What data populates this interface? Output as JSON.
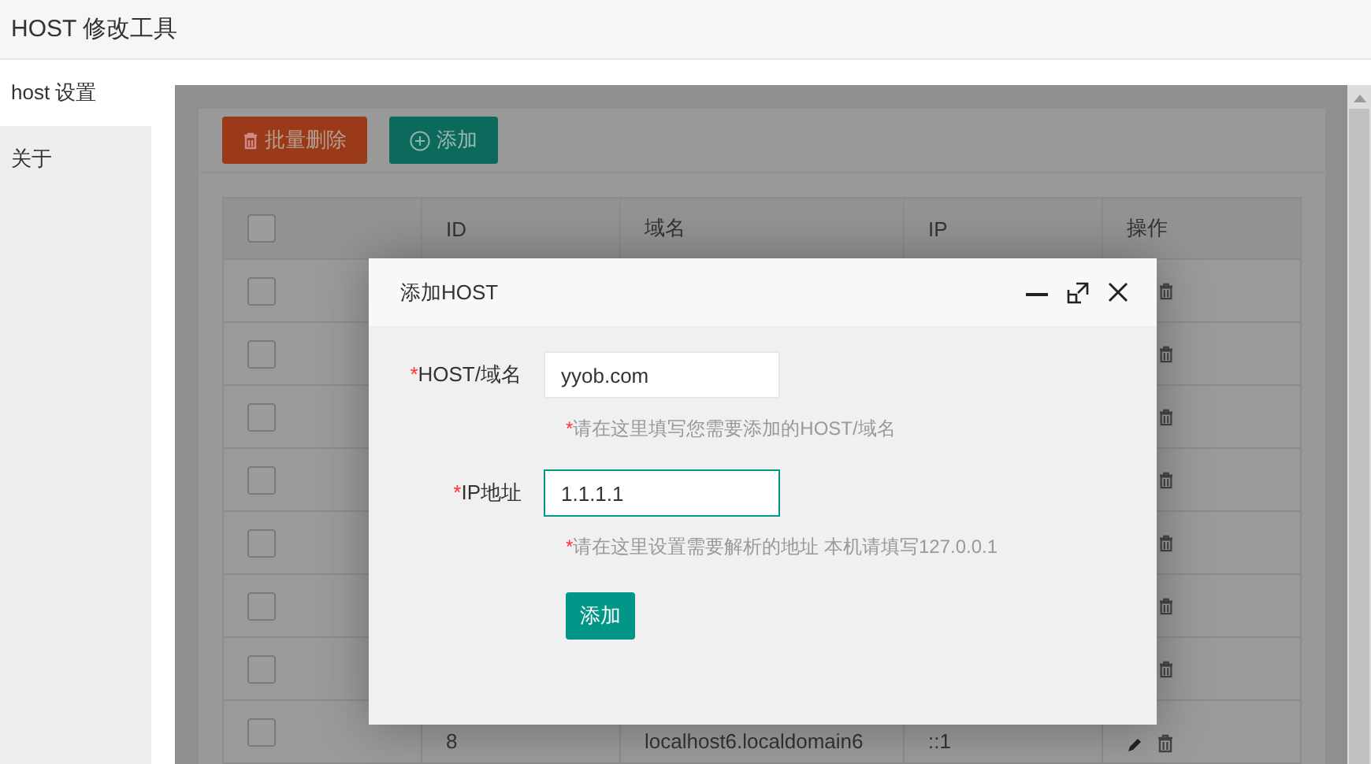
{
  "app_title": "HOST 修改工具",
  "sidebar": {
    "items": [
      {
        "label": "host 设置",
        "selected": true
      },
      {
        "label": "关于",
        "selected": false
      }
    ]
  },
  "toolbar": {
    "buttons": [
      {
        "label": "批量删除",
        "kind": "danger"
      },
      {
        "label": "添加",
        "kind": "add"
      }
    ]
  },
  "table": {
    "columns": [
      "ID",
      "域名",
      "IP",
      "操作"
    ],
    "all_checked": false,
    "rows": [
      {
        "checked": false
      },
      {
        "checked": false
      },
      {
        "checked": false
      },
      {
        "checked": false
      },
      {
        "checked": false
      },
      {
        "checked": false
      },
      {
        "checked": false
      },
      {
        "checked": false,
        "id": "8",
        "domain": "localhost6.localdomain6",
        "ip": "::1"
      }
    ]
  },
  "dialog": {
    "title": "添加HOST",
    "fields": [
      {
        "mark": "*",
        "label": "HOST/域名",
        "value": "yyob.com",
        "focused": false,
        "hint_mark": "*",
        "hint": "请在这里填写您需要添加的HOST/域名"
      },
      {
        "mark": "*",
        "label": "IP地址",
        "value": "1.1.1.1",
        "focused": true,
        "hint_mark": "*",
        "hint": "请在这里设置需要解析的地址 本机请填写127.0.0.1"
      }
    ],
    "submit": "添加"
  }
}
